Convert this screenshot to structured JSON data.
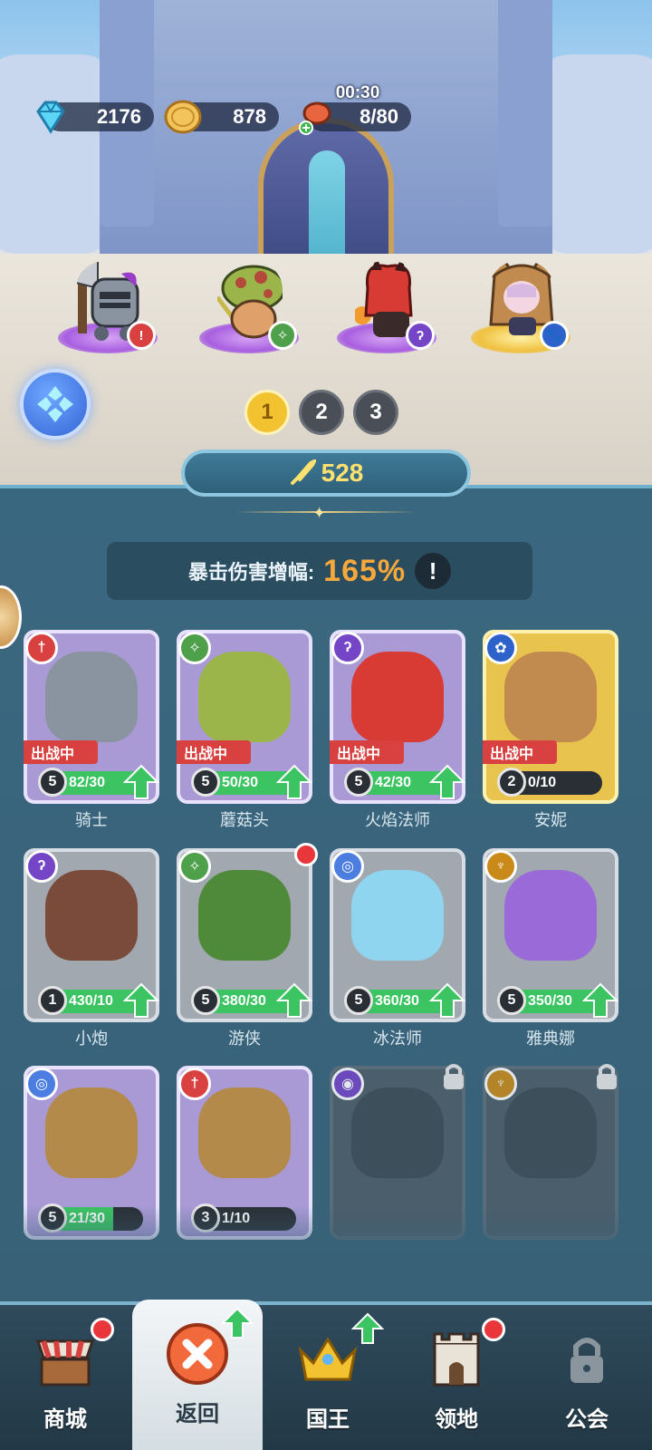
{
  "resources": {
    "gems": "2176",
    "coins": "878",
    "food": "8/80",
    "timer": "00:30"
  },
  "power": "528",
  "team_pages": [
    "1",
    "2",
    "3"
  ],
  "active_page": "1",
  "crit": {
    "label": "暴击伤害增幅:",
    "value": "165%",
    "info": "!"
  },
  "heroes": [
    {
      "name": "骑士",
      "level": "5",
      "progress": "82/30",
      "progress_fraction": 1.0,
      "deployed": "出战中",
      "class_icon": "sword-icon",
      "card": "purple",
      "upgradable": true
    },
    {
      "name": "蘑菇头",
      "level": "5",
      "progress": "50/30",
      "progress_fraction": 1.0,
      "deployed": "出战中",
      "class_icon": "constellation-icon",
      "card": "purple",
      "upgradable": true
    },
    {
      "name": "火焰法师",
      "level": "5",
      "progress": "42/30",
      "progress_fraction": 1.0,
      "deployed": "出战中",
      "class_icon": "staff-icon",
      "card": "purple",
      "upgradable": true
    },
    {
      "name": "安妮",
      "level": "2",
      "progress": "0/10",
      "progress_fraction": 0.0,
      "deployed": "出战中",
      "class_icon": "paw-icon",
      "card": "gold",
      "upgradable": false
    },
    {
      "name": "小炮",
      "level": "1",
      "progress": "430/10",
      "progress_fraction": 1.0,
      "deployed": "",
      "class_icon": "staff-icon",
      "card": "gray",
      "upgradable": true
    },
    {
      "name": "游侠",
      "level": "5",
      "progress": "380/30",
      "progress_fraction": 1.0,
      "deployed": "",
      "class_icon": "constellation-icon",
      "card": "gray",
      "upgradable": true,
      "notify": true
    },
    {
      "name": "冰法师",
      "level": "5",
      "progress": "360/30",
      "progress_fraction": 1.0,
      "deployed": "",
      "class_icon": "swirl-icon",
      "card": "gray",
      "upgradable": true
    },
    {
      "name": "雅典娜",
      "level": "5",
      "progress": "350/30",
      "progress_fraction": 1.0,
      "deployed": "",
      "class_icon": "wings-icon",
      "card": "gray",
      "upgradable": true
    },
    {
      "name": "",
      "level": "5",
      "progress": "21/30",
      "progress_fraction": 0.7,
      "deployed": "",
      "class_icon": "swirl-icon",
      "card": "purple",
      "upgradable": false
    },
    {
      "name": "",
      "level": "3",
      "progress": "1/10",
      "progress_fraction": 0.1,
      "deployed": "",
      "class_icon": "sword-icon",
      "card": "purple",
      "upgradable": false
    },
    {
      "name": "",
      "level": "",
      "progress": "",
      "progress_fraction": 0.0,
      "deployed": "",
      "class_icon": "eye-icon",
      "card": "locked",
      "upgradable": false
    },
    {
      "name": "",
      "level": "",
      "progress": "",
      "progress_fraction": 0.0,
      "deployed": "",
      "class_icon": "wings-icon",
      "card": "locked",
      "upgradable": false
    }
  ],
  "nav": {
    "shop": "商城",
    "back": "返回",
    "king": "国王",
    "territory": "领地",
    "guild": "公会"
  },
  "colors": {
    "accent_gold": "#f2c230",
    "crit_orange": "#f6a83c",
    "progress_green": "#3cc463",
    "deploy_red": "#d8413f",
    "notify_red": "#e8363b"
  }
}
